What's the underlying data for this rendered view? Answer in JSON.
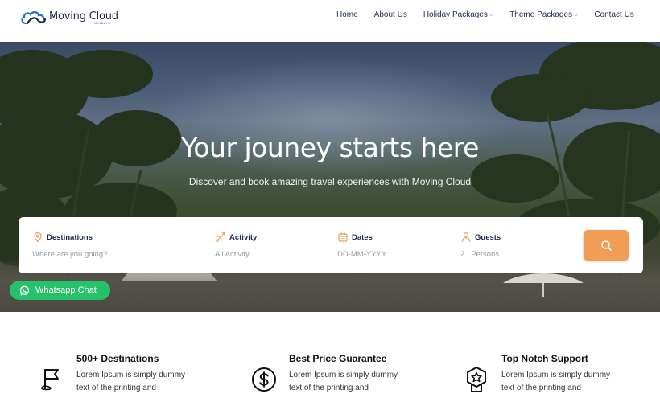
{
  "brand": {
    "name": "Moving Cloud",
    "tagline": "HOLIDAYS"
  },
  "nav": [
    {
      "label": "Home",
      "has_dropdown": false
    },
    {
      "label": "About Us",
      "has_dropdown": false
    },
    {
      "label": "Holiday Packages",
      "has_dropdown": true
    },
    {
      "label": "Theme Packages",
      "has_dropdown": true
    },
    {
      "label": "Contact Us",
      "has_dropdown": false
    }
  ],
  "hero": {
    "title": "Your jouney starts here",
    "subtitle": "Discover and book amazing travel experiences with Moving Cloud"
  },
  "search": {
    "destinations": {
      "label": "Destinations",
      "placeholder": "Where are you going?",
      "icon": "location-pin-icon"
    },
    "activity": {
      "label": "Activity",
      "value": "All Activity",
      "icon": "plane-icon"
    },
    "dates": {
      "label": "Dates",
      "placeholder": "DD-MM-YYYY",
      "icon": "calendar-icon"
    },
    "guests": {
      "label": "Guests",
      "count": "2",
      "unit": "Persons",
      "icon": "person-icon"
    },
    "button_icon": "search-icon"
  },
  "whatsapp": {
    "label": "Whatsapp Chat"
  },
  "features": [
    {
      "title": "500+ Destinations",
      "line1": "Lorem Ipsum is simply dummy",
      "line2": "text of the printing and",
      "icon": "flag-icon"
    },
    {
      "title": "Best Price Guarantee",
      "line1": "Lorem Ipsum is simply dummy",
      "line2": "text of the printing and",
      "icon": "dollar-icon"
    },
    {
      "title": "Top Notch Support",
      "line1": "Lorem Ipsum is simply dummy",
      "line2": "text of the printing and",
      "icon": "badge-icon"
    }
  ],
  "colors": {
    "accent": "#f29d56",
    "navy": "#1e2a4d",
    "whatsapp": "#25c26a"
  }
}
